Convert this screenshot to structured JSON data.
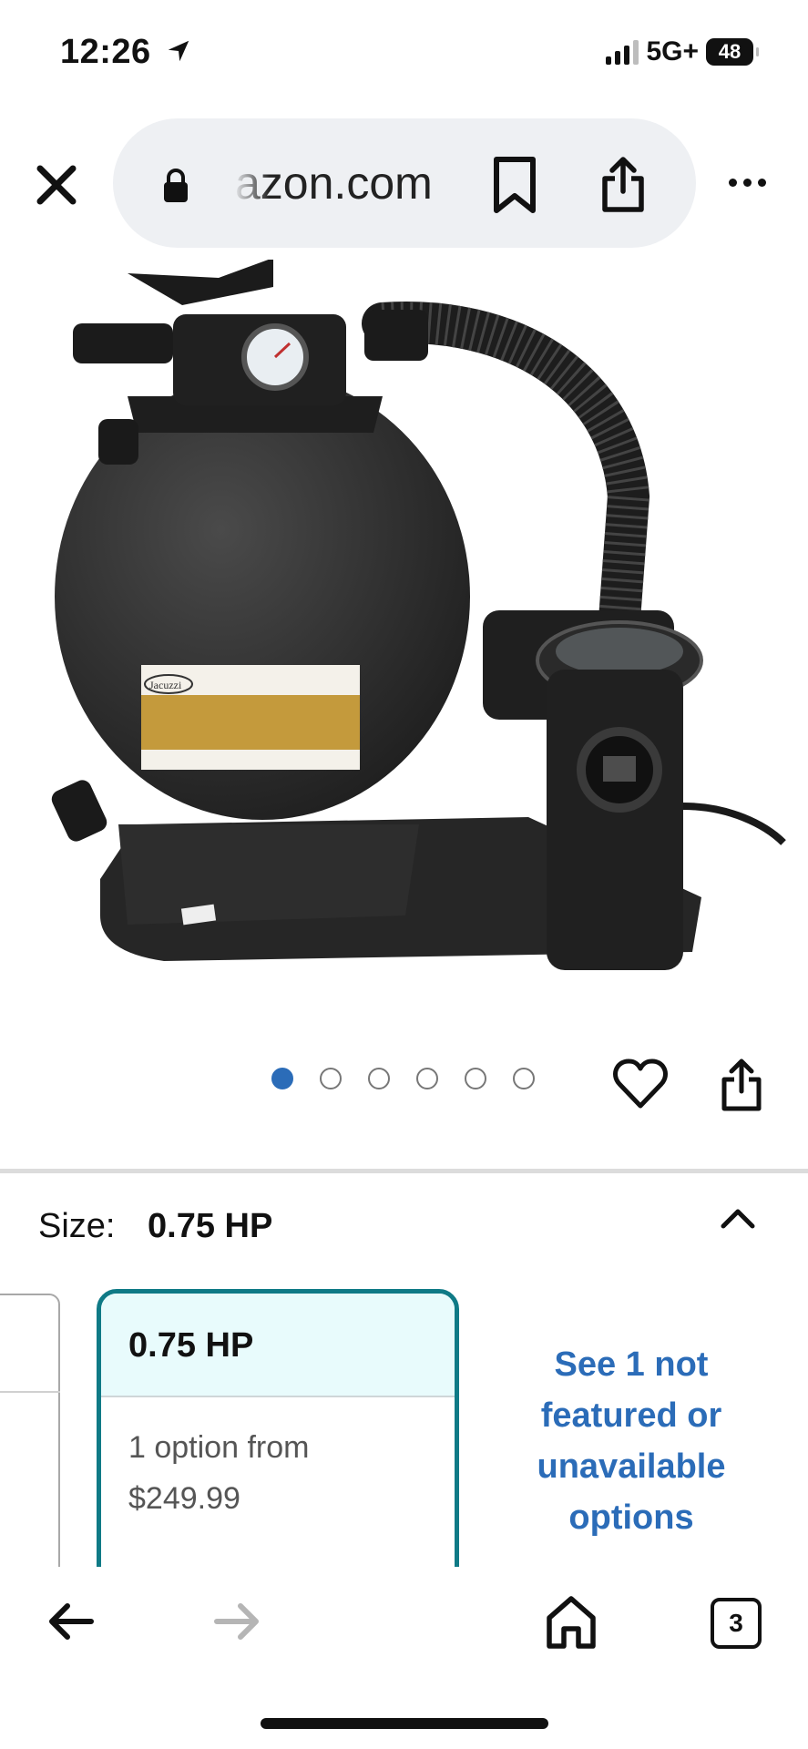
{
  "status_bar": {
    "time": "12:26",
    "network": "5G+",
    "battery": "48"
  },
  "browser": {
    "url": "azon.com",
    "icons": {
      "close": "close-icon",
      "lock": "lock-icon",
      "bookmark": "bookmark-icon",
      "share": "share-icon",
      "more": "more-icon"
    }
  },
  "product": {
    "image_label": "Jacuzzi",
    "carousel": {
      "total": 6,
      "active_index": 0
    },
    "icons": {
      "favorite": "heart-icon",
      "share": "share-icon"
    }
  },
  "size_selector": {
    "label": "Size:",
    "value": "0.75 HP",
    "selected_option": {
      "title": "0.75 HP",
      "line1": "1 option from",
      "price": "$249.99"
    },
    "see_more": "See 1 not featured or unavailable options"
  },
  "toolbar": {
    "tabs_count": "3",
    "icons": [
      "back-arrow-icon",
      "forward-arrow-icon",
      "home-icon",
      "tabs-icon"
    ]
  },
  "colors": {
    "accent_blue": "#2b6cb8",
    "selected_teal": "#0f7a86",
    "card_head_bg": "#e8fbfc"
  }
}
